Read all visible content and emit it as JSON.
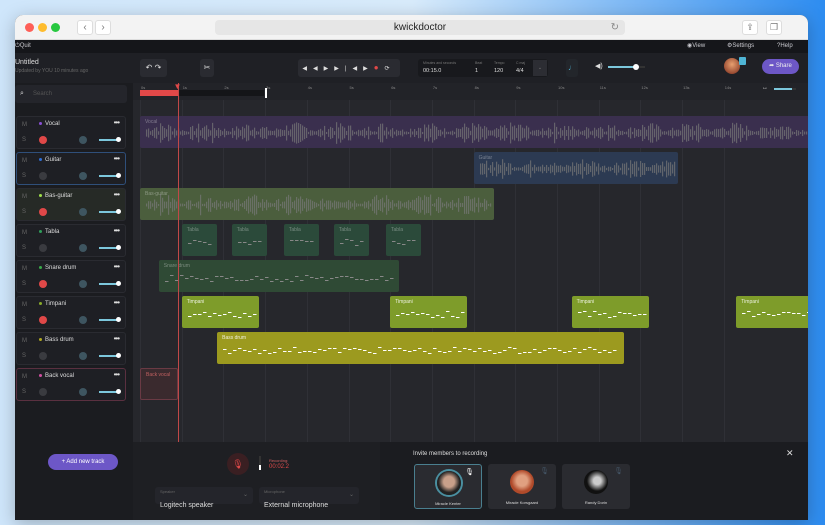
{
  "browser": {
    "url": "kwickdoctor"
  },
  "appbar": {
    "quit": "Quit",
    "view": "View",
    "settings": "Settings",
    "help": "Help"
  },
  "project": {
    "title": "Untitled",
    "subtitle": "Updated by YOU 10 minutes ago"
  },
  "toolbar": {
    "time_label": "Minutes and seconds",
    "time": "00:15.0",
    "beat_label": "Beat",
    "beat": "1",
    "tempo_label": "Tempo",
    "tempo": "120",
    "cmaj_label": "C maj",
    "signature": "4/4",
    "volume": 0.75,
    "share": "Share",
    "zoom": 0.8
  },
  "sidebar": {
    "search_placeholder": "Search",
    "add_track": "Add new track",
    "tracks": [
      {
        "name": "Vocal",
        "color": "#8a4fd6",
        "rec": true,
        "active": false
      },
      {
        "name": "Guitar",
        "color": "#2f6fd6",
        "rec": false,
        "active": true
      },
      {
        "name": "Bas-guitar",
        "color": "#9fe04a",
        "rec": true,
        "active": false
      },
      {
        "name": "Tabla",
        "color": "#2f9e5a",
        "rec": false,
        "active": false
      },
      {
        "name": "Snare drum",
        "color": "#3aaa4a",
        "rec": true,
        "active": false
      },
      {
        "name": "Timpani",
        "color": "#8aaa2a",
        "rec": true,
        "active": false
      },
      {
        "name": "Bass drum",
        "color": "#b0a820",
        "rec": false,
        "active": false
      },
      {
        "name": "Back vocal",
        "color": "#d04fa0",
        "rec": false,
        "active": false
      }
    ]
  },
  "timeline": {
    "ticks": [
      "0s",
      "1s",
      "2s",
      "3s",
      "4s",
      "5s",
      "6s",
      "7s",
      "8s",
      "9s",
      "10s",
      "11s",
      "12s",
      "13s",
      "14s"
    ],
    "playhead": 0.9,
    "loop_end": 3,
    "clips": [
      {
        "track": 0,
        "label": "Vocal",
        "start": 0,
        "end": 16.5,
        "color": "#3a2f4e",
        "kind": "wave"
      },
      {
        "track": 1,
        "label": "Guitar",
        "start": 8,
        "end": 12.9,
        "color": "#2c3a52",
        "kind": "wave"
      },
      {
        "track": 2,
        "label": "Bas-guitar",
        "start": 0,
        "end": 8.5,
        "color": "#4b5e3d",
        "kind": "wave"
      },
      {
        "track": 3,
        "label": "Tabla",
        "start": 1,
        "end": 1.85,
        "color": "#2b4a3a",
        "kind": "midi"
      },
      {
        "track": 3,
        "label": "Tabla",
        "start": 2.2,
        "end": 3.05,
        "color": "#2b4a3a",
        "kind": "midi"
      },
      {
        "track": 3,
        "label": "Tabla",
        "start": 3.45,
        "end": 4.3,
        "color": "#2b4a3a",
        "kind": "midi"
      },
      {
        "track": 3,
        "label": "Tabla",
        "start": 4.65,
        "end": 5.5,
        "color": "#2b4a3a",
        "kind": "midi"
      },
      {
        "track": 3,
        "label": "Tabla",
        "start": 5.9,
        "end": 6.75,
        "color": "#2b4a3a",
        "kind": "midi"
      },
      {
        "track": 4,
        "label": "Snare drum",
        "start": 0.45,
        "end": 6.2,
        "color": "#2f4a35",
        "kind": "midi"
      },
      {
        "track": 5,
        "label": "Timpani",
        "start": 1,
        "end": 2.85,
        "color": "#7e9c2a",
        "kind": "midi",
        "bright": true
      },
      {
        "track": 5,
        "label": "Timpani",
        "start": 6,
        "end": 7.85,
        "color": "#7e9c2a",
        "kind": "midi",
        "bright": true
      },
      {
        "track": 5,
        "label": "Timpani",
        "start": 10.35,
        "end": 12.2,
        "color": "#7e9c2a",
        "kind": "midi",
        "bright": true
      },
      {
        "track": 5,
        "label": "Timpani",
        "start": 14.3,
        "end": 16.5,
        "color": "#7e9c2a",
        "kind": "midi",
        "bright": true
      },
      {
        "track": 6,
        "label": "Bass drum",
        "start": 1.85,
        "end": 11.6,
        "color": "#9c9a1f",
        "kind": "midi",
        "bright": true
      },
      {
        "track": 7,
        "label": "Back vocal",
        "start": 0,
        "end": 0.9,
        "color": "#3a2a2e",
        "kind": "empty"
      }
    ]
  },
  "recording": {
    "label": "Recording:",
    "time": "00:02.2",
    "speaker_label": "Speaker",
    "speaker": "Logitech speaker",
    "mic_label": "Microphone",
    "mic": "External microphone"
  },
  "invite": {
    "title": "Invite members to recording",
    "members": [
      {
        "name": "Miracle Kenter",
        "active": true
      },
      {
        "name": "Miracle Korsgaard",
        "active": false
      },
      {
        "name": "Randy Dorin",
        "active": false
      }
    ]
  }
}
